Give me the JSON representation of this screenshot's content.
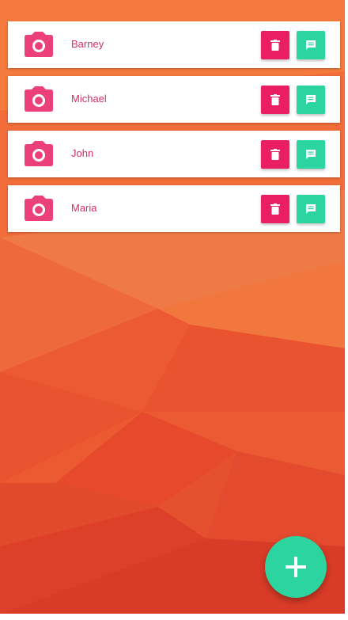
{
  "colors": {
    "background_top": "#f47b3e",
    "background_bottom": "#db3c26",
    "card": "#ffffff",
    "accent_pink": "#e91e63",
    "name_text": "#d52e6b",
    "accent_green": "#2cd4a0"
  },
  "contacts": [
    {
      "name": "Barney",
      "avatar_icon": "camera-icon",
      "delete_icon": "trash-icon",
      "message_icon": "message-icon"
    },
    {
      "name": "Michael",
      "avatar_icon": "camera-icon",
      "delete_icon": "trash-icon",
      "message_icon": "message-icon"
    },
    {
      "name": "John",
      "avatar_icon": "camera-icon",
      "delete_icon": "trash-icon",
      "message_icon": "message-icon"
    },
    {
      "name": "Maria",
      "avatar_icon": "camera-icon",
      "delete_icon": "trash-icon",
      "message_icon": "message-icon"
    }
  ],
  "fab": {
    "icon": "plus-icon"
  }
}
